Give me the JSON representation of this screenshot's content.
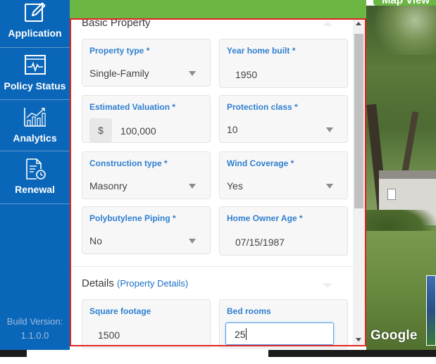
{
  "sidebar": {
    "items": [
      {
        "label": "Application",
        "icon": "edit-icon"
      },
      {
        "label": "Policy Status",
        "icon": "pulse-monitor-icon"
      },
      {
        "label": "Analytics",
        "icon": "bar-chart-icon"
      },
      {
        "label": "Renewal",
        "icon": "document-clock-icon"
      }
    ],
    "build_label": "Build Version:",
    "build_version": "1.1.0.0"
  },
  "map_button": "Map View",
  "google_label": "Google",
  "basic_property": {
    "title": "Basic Property",
    "fields": {
      "property_type": {
        "label": "Property type *",
        "value": "Single-Family"
      },
      "year_home_built": {
        "label": "Year home built *",
        "value": "1950"
      },
      "estimated_valuation": {
        "label": "Estimated Valuation *",
        "prefix": "$",
        "value": "100,000"
      },
      "protection_class": {
        "label": "Protection class *",
        "value": "10"
      },
      "construction_type": {
        "label": "Construction type *",
        "value": "Masonry"
      },
      "wind_coverage": {
        "label": "Wind Coverage *",
        "value": "Yes"
      },
      "polybutylene_piping": {
        "label": "Polybutylene Piping *",
        "value": "No"
      },
      "home_owner_age": {
        "label": "Home Owner Age *",
        "value": "07/15/1987"
      }
    }
  },
  "details": {
    "title": "Details",
    "subtitle": "(Property Details)",
    "fields": {
      "square_footage": {
        "label": "Square footage",
        "value": "1500"
      },
      "bed_rooms": {
        "label": "Bed rooms",
        "value": "25"
      }
    }
  },
  "colors": {
    "sidebar": "#0a66b8",
    "accent_green": "#6cb744",
    "label_blue": "#2f7fd0",
    "highlight_border": "#e02424"
  }
}
